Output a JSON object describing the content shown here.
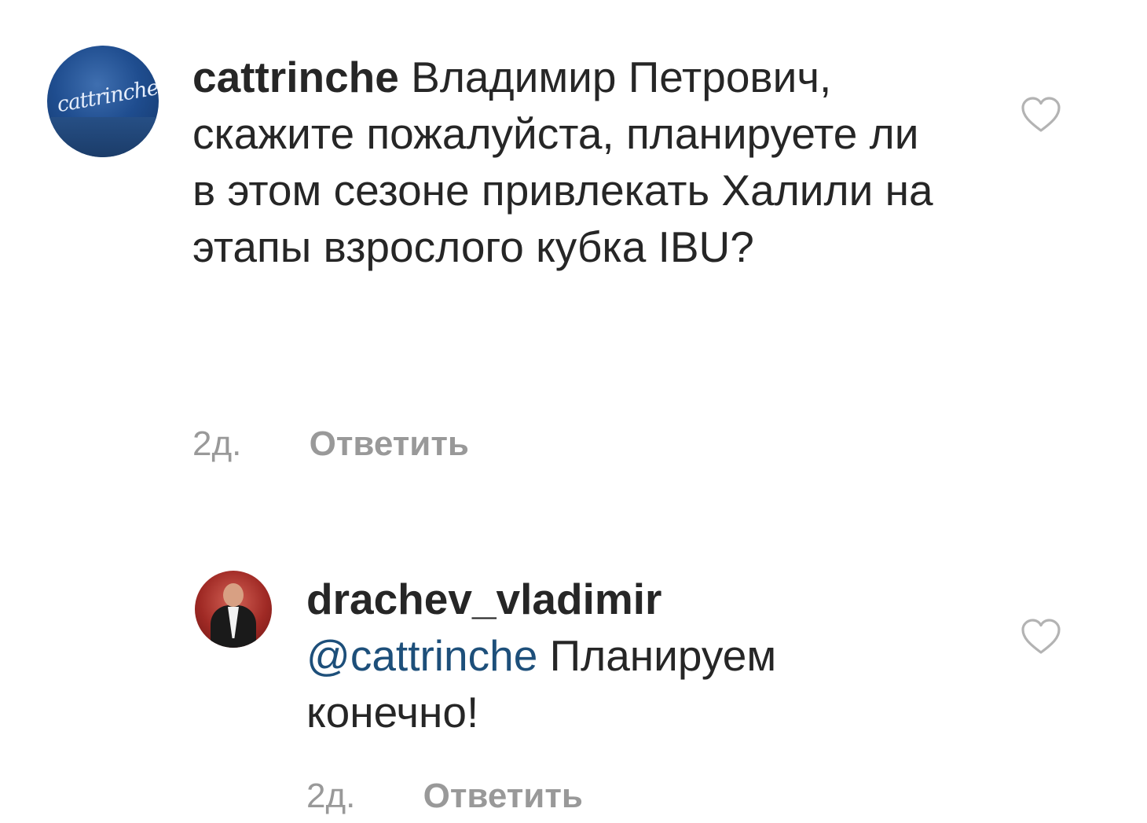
{
  "comments": [
    {
      "avatar": {
        "text": "cattrinche"
      },
      "username": "cattrinche",
      "text": "Владимир Петрович, скажите пожалуйста, планируете ли в этом сезоне привлекать Халили на этапы взрослого кубка IBU?",
      "time": "2д.",
      "reply_label": "Ответить",
      "like_icon": "heart-outline-icon"
    },
    {
      "username": "drachev_vladimir",
      "mention": "@cattrinche",
      "text": "Планируем конечно!",
      "time": "2д.",
      "reply_label": "Ответить",
      "like_icon": "heart-outline-icon"
    }
  ],
  "colors": {
    "text": "#262626",
    "meta": "#999999",
    "mention": "#1d4f7a",
    "heart_stroke": "#b3b3b3"
  }
}
